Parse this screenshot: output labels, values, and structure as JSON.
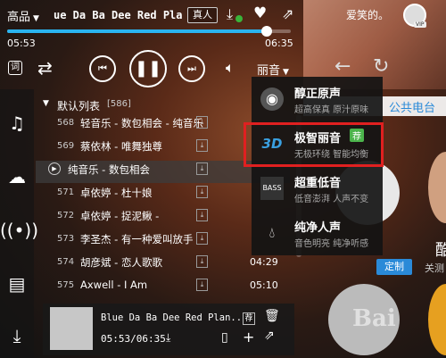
{
  "header": {
    "quality_label": "高品",
    "now_playing_title": "ue Da Ba Dee Red Planet F",
    "real_badge": "真人",
    "username": "爱笑的。",
    "vip_label": "VIP",
    "download_icon": "download-icon",
    "heart_icon": "heart-icon",
    "share_icon": "share-icon"
  },
  "progress": {
    "elapsed": "05:53",
    "total": "06:35",
    "fraction": 0.915
  },
  "controls": {
    "lyrics_label": "词",
    "sound_effect_label": "丽音"
  },
  "playlist": {
    "header": "默认列表",
    "count": "[586]",
    "rows": [
      {
        "num": "568",
        "name": "轻音乐 - 数包相会 - 纯音乐",
        "dur": ""
      },
      {
        "num": "569",
        "name": "蔡依林 - 唯舞独尊",
        "dur": ""
      },
      {
        "num": "",
        "name": "纯音乐 - 数包相会",
        "dur": ""
      },
      {
        "num": "571",
        "name": "卓依婷 - 杜十娘",
        "dur": ""
      },
      {
        "num": "572",
        "name": "卓依婷 - 捉泥鳅 -",
        "dur": ""
      },
      {
        "num": "573",
        "name": "李圣杰 - 有一种爱叫放手",
        "dur": ""
      },
      {
        "num": "574",
        "name": "胡彦斌 - 恋人歌歌",
        "dur": "04:29"
      },
      {
        "num": "575",
        "name": "Axwell - I Am",
        "dur": "05:10"
      }
    ]
  },
  "mini_player": {
    "title": "Blue Da Ba Dee Red Plan...",
    "time": "05:53/06:35"
  },
  "right_panel": {
    "tab": "公共电台",
    "custom_button": "定制",
    "artist_char": "酷",
    "caption": "关测"
  },
  "dropdown": {
    "items": [
      {
        "title": "醇正原声",
        "sub": "超高保真  原汁原味",
        "badge": ""
      },
      {
        "title": "极智丽音",
        "sub": "无极环绕  智能均衡",
        "badge": "荐"
      },
      {
        "title": "超重低音",
        "sub": "低音澎湃  人声不变",
        "badge": ""
      },
      {
        "title": "纯净人声",
        "sub": "音色明亮  纯净听感",
        "badge": ""
      }
    ],
    "bass_label": "BASS",
    "three_d_label": "3D"
  },
  "watermark": "Bai",
  "accent_color": "#2ab4f0",
  "highlight_color": "#e02020"
}
